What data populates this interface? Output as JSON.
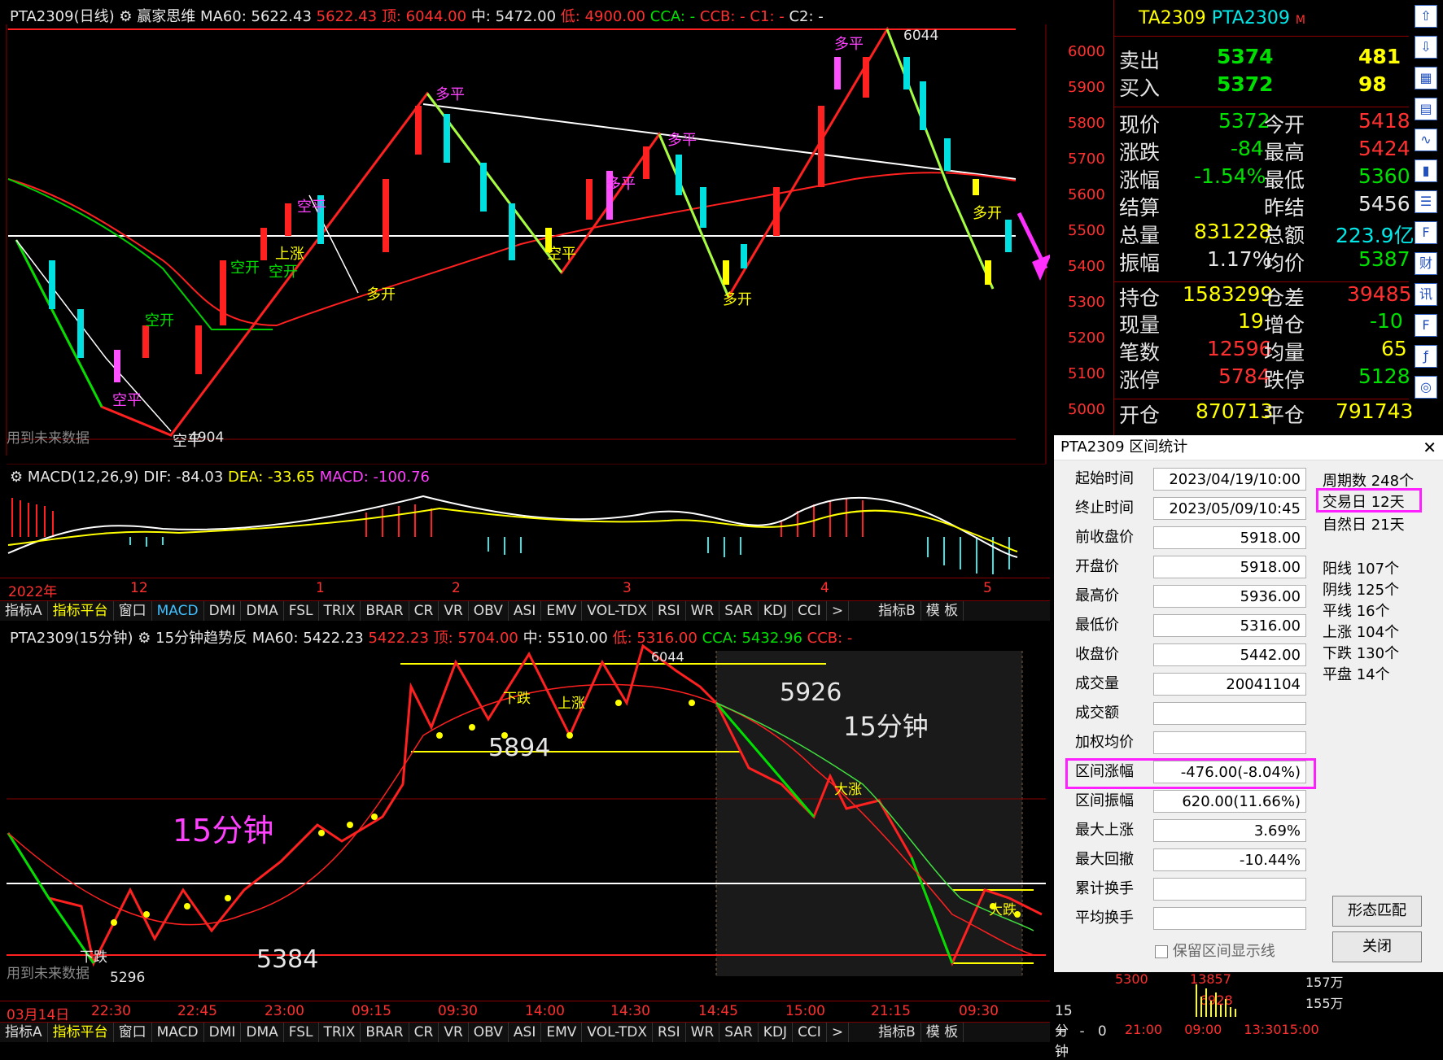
{
  "top_header": {
    "symbol": "PTA2309(日线)",
    "indicator": "赢家思维",
    "ma60": "MA60: 5622.43",
    "ma60b": "5622.43",
    "top": "顶: 6044.00",
    "mid": "中: 5472.00",
    "low": "低: 4900.00",
    "cca": "CCA: -",
    "ccb": "CCB: -",
    "c1": "C1: -",
    "c2": "C2: -"
  },
  "top_chart": {
    "price_ticks": [
      "6000",
      "5900",
      "5800",
      "5700",
      "5600",
      "5500",
      "5400",
      "5300",
      "5200",
      "5100",
      "5000"
    ],
    "labels": {
      "high_value": "6044",
      "low_value": "4904",
      "future_note": "用到未来数据",
      "dp1": "多平",
      "dp2": "多平",
      "dp3": "多平",
      "dp4": "多平",
      "dk1": "多开",
      "dk2": "多开",
      "dk3": "多开",
      "kp1": "空平",
      "kp2": "空平",
      "kk1": "空开",
      "kk2": "空开",
      "kp3": "空平",
      "sz1": "上涨",
      "dp5": "多平",
      "kp4": "空平",
      "kk3": "空开"
    }
  },
  "macd": {
    "title": "MACD(12,26,9)",
    "dif": "DIF: -84.03",
    "dea": "DEA: -33.65",
    "macd": "MACD: -100.76"
  },
  "time_axis_top": [
    "2022年",
    "12",
    "1",
    "2",
    "3",
    "4",
    "5"
  ],
  "tabs_top": [
    "指标A",
    "指标平台",
    "窗口",
    "MACD",
    "DMI",
    "DMA",
    "FSL",
    "TRIX",
    "BRAR",
    "CR",
    "VR",
    "OBV",
    "ASI",
    "EMV",
    "VOL-TDX",
    "RSI",
    "WR",
    "SAR",
    "KDJ",
    "CCI",
    ">",
    "指标B",
    "模 板"
  ],
  "bottom_header": {
    "symbol": "PTA2309(15分钟)",
    "indicator": "15分钟趋势反",
    "ma60": "MA60: 5422.23",
    "ma60b": "5422.23",
    "top": "顶: 5704.00",
    "mid": "中: 5510.00",
    "low": "低: 5316.00",
    "cca": "CCA: 5432.96",
    "ccb": "CCB: -"
  },
  "bottom_chart": {
    "label_5926": "5926",
    "label_5894": "5894",
    "label_5384": "5384",
    "label_15min": "15分钟",
    "label_15min_mag": "15分钟",
    "high_value": "6044",
    "low_value": "5296",
    "future_note": "用到未来数据",
    "xiadie": "下跌",
    "shangzhang": "上涨",
    "dazhang": "大涨",
    "xiadie2": "下跌",
    "dadie": "大跌",
    "period": "15分钟"
  },
  "time_axis_bottom": [
    "03月14日",
    "22:30",
    "22:45",
    "23:00",
    "09:15",
    "09:30",
    "14:00",
    "14:30",
    "14:45",
    "15:00",
    "21:15",
    "09:30"
  ],
  "tabs_bottom": [
    "指标A",
    "指标平台",
    "窗口",
    "MACD",
    "DMI",
    "DMA",
    "FSL",
    "TRIX",
    "BRAR",
    "CR",
    "VR",
    "OBV",
    "ASI",
    "EMV",
    "VOL-TDX",
    "RSI",
    "WR",
    "SAR",
    "KDJ",
    "CCI",
    ">",
    "指标B",
    "模 板"
  ],
  "bottom_right_status": [
    "+",
    "-",
    "0"
  ],
  "quote": {
    "code": "TA2309",
    "name": "PTA2309",
    "flag": "M",
    "ask_label": "卖出",
    "ask_price": "5374",
    "ask_vol": "481",
    "bid_label": "买入",
    "bid_price": "5372",
    "bid_vol": "98",
    "rows": [
      {
        "l1": "现价",
        "v1": "5372",
        "l2": "今开",
        "v2": "5418"
      },
      {
        "l1": "涨跌",
        "v1": "-84",
        "l2": "最高",
        "v2": "5424"
      },
      {
        "l1": "涨幅",
        "v1": "-1.54%",
        "l2": "最低",
        "v2": "5360"
      },
      {
        "l1": "结算",
        "v1": "",
        "l2": "昨结",
        "v2": "5456"
      },
      {
        "l1": "总量",
        "v1": "831228",
        "l2": "总额",
        "v2": "223.9亿"
      },
      {
        "l1": "振幅",
        "v1": "1.17%",
        "l2": "均价",
        "v2": "5387"
      },
      {
        "l1": "持仓",
        "v1": "1583299",
        "l2": "仓差",
        "v2": "39485"
      },
      {
        "l1": "现量",
        "v1": "19",
        "l2": "增仓",
        "v2": "-10"
      },
      {
        "l1": "笔数",
        "v1": "12596",
        "l2": "均量",
        "v2": "65"
      },
      {
        "l1": "涨停",
        "v1": "5784",
        "l2": "跌停",
        "v2": "5128"
      },
      {
        "l1": "开仓",
        "v1": "870713",
        "l2": "平仓",
        "v2": "791743"
      }
    ],
    "mini": {
      "v1": "13857",
      "v2": "6928",
      "r1": "157万",
      "r2": "155万",
      "t1": "21:00",
      "t2": "09:00",
      "t3": "13:30",
      "t4": "15:00",
      "price": "5300"
    }
  },
  "dialog": {
    "title": "PTA2309 区间统计",
    "fields": [
      {
        "label": "起始时间",
        "value": "2023/04/19/10:00"
      },
      {
        "label": "终止时间",
        "value": "2023/05/09/10:45"
      },
      {
        "label": "前收盘价",
        "value": "5918.00"
      },
      {
        "label": "开盘价",
        "value": "5918.00"
      },
      {
        "label": "最高价",
        "value": "5936.00"
      },
      {
        "label": "最低价",
        "value": "5316.00"
      },
      {
        "label": "收盘价",
        "value": "5442.00"
      },
      {
        "label": "成交量",
        "value": "20041104"
      },
      {
        "label": "成交额",
        "value": ""
      },
      {
        "label": "加权均价",
        "value": ""
      },
      {
        "label": "区间涨幅",
        "value": "-476.00(-8.04%)"
      },
      {
        "label": "区间振幅",
        "value": "620.00(11.66%)"
      },
      {
        "label": "最大上涨",
        "value": "3.69%"
      },
      {
        "label": "最大回撤",
        "value": "-10.44%"
      },
      {
        "label": "累计换手",
        "value": ""
      },
      {
        "label": "平均换手",
        "value": ""
      }
    ],
    "stats": [
      "周期数 248个",
      "交易日 12天",
      "自然日 21天",
      "阳线 107个",
      "阴线 125个",
      "平线 16个",
      "上涨 104个",
      "下跌 130个",
      "平盘 14个"
    ],
    "keep_label": "保留区间显示线",
    "pattern_btn": "形态匹配",
    "close_btn": "关闭"
  },
  "sidebar_icons": [
    "up-arrow-icon",
    "down-arrow-icon",
    "chart-icon",
    "grid-icon",
    "line-icon",
    "candle-icon",
    "list-icon",
    "f10-icon",
    "finance-icon",
    "info-icon",
    "f2-icon",
    "formula-icon",
    "zoom-icon"
  ]
}
